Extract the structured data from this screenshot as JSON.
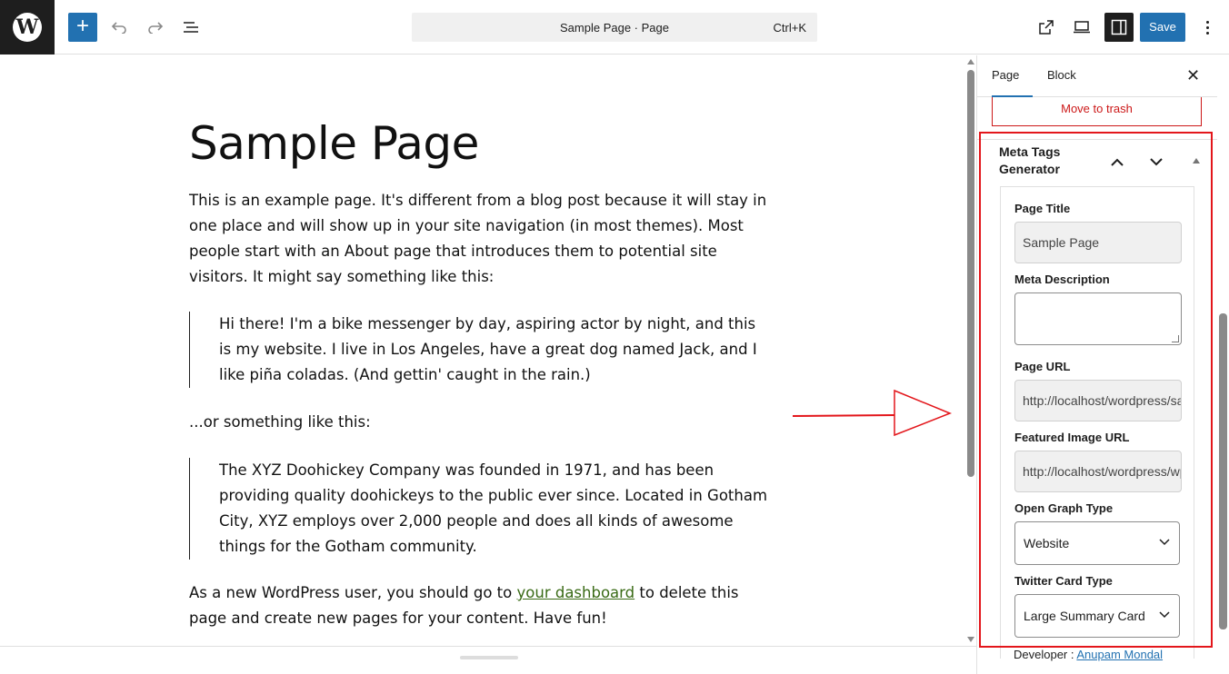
{
  "topbar": {
    "document_title": "Sample Page · Page",
    "shortcut": "Ctrl+K",
    "save_label": "Save",
    "add_icon": "plus-icon",
    "undo_icon": "undo-icon",
    "redo_icon": "redo-icon",
    "list_icon": "list-view-icon",
    "view_icon": "external-view-icon",
    "preview_icon": "desktop-preview-icon",
    "settings_icon": "settings-sidebar-icon",
    "more_icon": "more-vertical-icon",
    "accent": "#2271b1"
  },
  "editor": {
    "title": "Sample Page",
    "paragraph1": "This is an example page. It's different from a blog post because it will stay in one place and will show up in your site navigation (in most themes). Most people start with an About page that introduces them to potential site visitors. It might say something like this:",
    "quote1": "Hi there! I'm a bike messenger by day, aspiring actor by night, and this is my website. I live in Los Angeles, have a great dog named Jack, and I like piña coladas. (And gettin' caught in the rain.)",
    "paragraph2": "...or something like this:",
    "quote2": "The XYZ Doohickey Company was founded in 1971, and has been providing quality doohickeys to the public ever since. Located in Gotham City, XYZ employs over 2,000 people and does all kinds of awesome things for the Gotham community.",
    "paragraph3_before": "As a new WordPress user, you should go to ",
    "paragraph3_link": "your dashboard",
    "paragraph3_after": " to delete this page and create new pages for your content. Have fun!",
    "link_color": "#3a6b16"
  },
  "sidebar": {
    "tab_page": "Page",
    "tab_block": "Block",
    "close_icon": "close-icon",
    "trash_label": "Move to trash",
    "panel_title": "Meta Tags Generator",
    "highlight_color": "#e3161b",
    "fields": {
      "page_title_label": "Page Title",
      "page_title_value": "Sample Page",
      "meta_description_label": "Meta Description",
      "meta_description_value": "",
      "page_url_label": "Page URL",
      "page_url_value": "http://localhost/wordpress/sample-page/",
      "featured_image_label": "Featured Image URL",
      "featured_image_value": "http://localhost/wordpress/wp-content/",
      "og_type_label": "Open Graph Type",
      "og_type_value": "Website",
      "twitter_card_label": "Twitter Card Type",
      "twitter_card_value": "Large Summary Card"
    },
    "developer_prefix": "Developer : ",
    "developer_name": "Anupam Mondal"
  }
}
